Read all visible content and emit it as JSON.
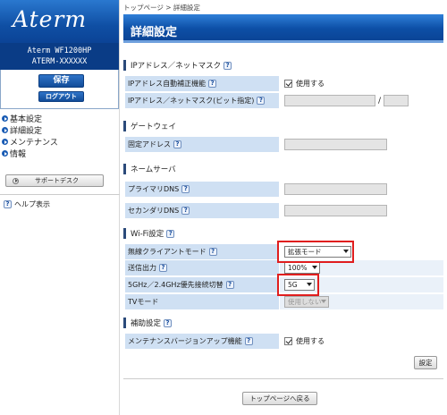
{
  "sidebar": {
    "logo": "Aterm",
    "model_line1": "Aterm WF1200HP",
    "model_line2": "ATERM-XXXXXX",
    "save_label": "保存",
    "logout_label": "ログアウト",
    "menu": [
      {
        "label": "基本設定"
      },
      {
        "label": "詳細設定"
      },
      {
        "label": "メンテナンス"
      },
      {
        "label": "情報"
      }
    ],
    "support_label": "サポートデスク",
    "help_label": "ヘルプ表示"
  },
  "breadcrumb": "トップページ > 詳細設定",
  "page_title": "詳細設定",
  "help_glyph": "?",
  "sections": {
    "ip_mask": {
      "title": "IPアドレス／ネットマスク",
      "auto_correct_label": "IPアドレス自動補正機能",
      "auto_correct_value": "使用する",
      "ip_mask_label": "IPアドレス／ネットマスク(ビット指定)",
      "slash": "/"
    },
    "gateway": {
      "title": "ゲートウェイ",
      "fixed_label": "固定アドレス"
    },
    "dns": {
      "title": "ネームサーバ",
      "primary_label": "プライマリDNS",
      "secondary_label": "セカンダリDNS"
    },
    "wifi": {
      "title": "Wi-Fi設定",
      "client_mode_label": "無線クライアントモード",
      "client_mode_value": "拡張モード",
      "tx_power_label": "送信出力",
      "tx_power_value": "100%",
      "band_pref_label": "5GHz／2.4GHz優先接続切替",
      "band_pref_value": "5G",
      "tv_mode_label": "TVモード",
      "tv_mode_value": "使用しない"
    },
    "aux": {
      "title": "補助設定",
      "maint_label": "メンテナンスバージョンアップ機能",
      "maint_value": "使用する"
    }
  },
  "settei_label": "設定",
  "back_label": "トップページへ戻る",
  "colors": {
    "brand_blue": "#0f4fa4",
    "label_bg": "#cfe0f3",
    "highlight_red": "#e01e1e"
  }
}
